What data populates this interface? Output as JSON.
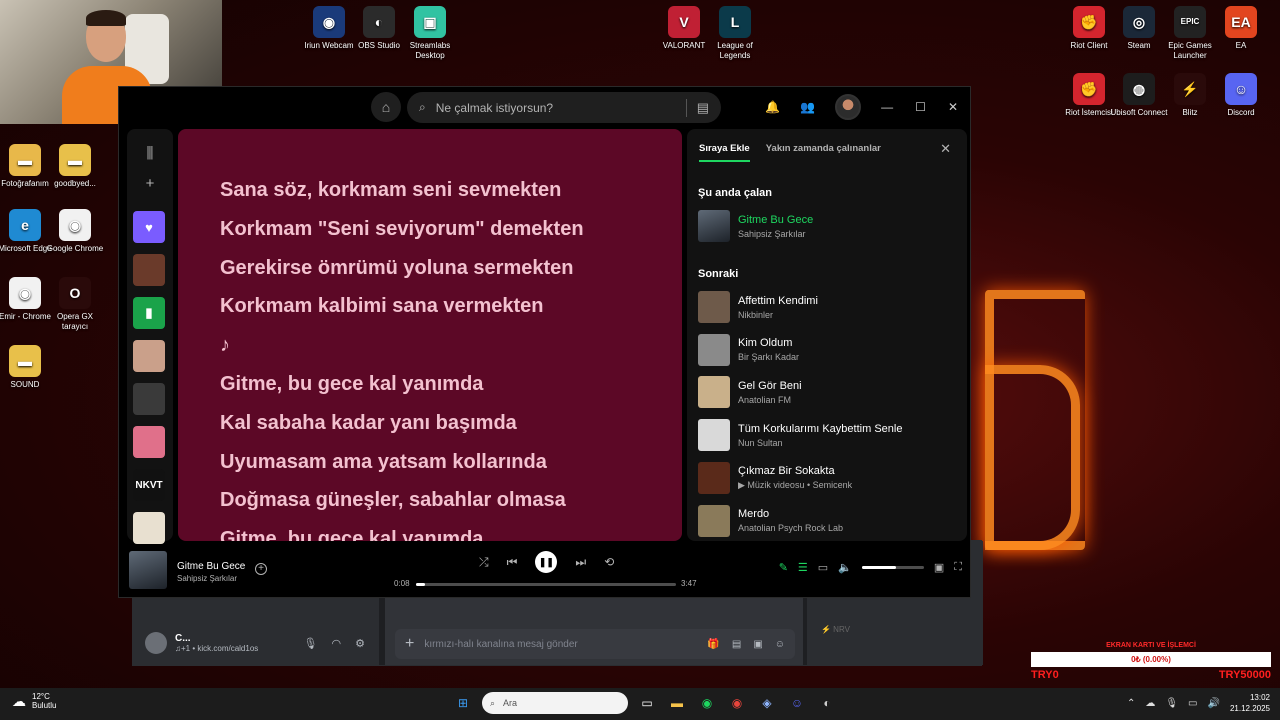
{
  "desktop_icons": [
    {
      "label": "Iriun Webcam",
      "color": "#1a3a7a",
      "glyph": "◉"
    },
    {
      "label": "OBS Studio",
      "color": "#2b2b2b",
      "glyph": "◐"
    },
    {
      "label": "Streamlabs Desktop",
      "color": "#31c3a2",
      "glyph": "▣"
    },
    {
      "label": "VALORANT",
      "color": "#c02034",
      "glyph": "V"
    },
    {
      "label": "League of Legends",
      "color": "#0b3a4a",
      "glyph": "L"
    },
    {
      "label": "Riot Client",
      "color": "#d4252e",
      "glyph": "✊"
    },
    {
      "label": "Steam",
      "color": "#1b2838",
      "glyph": "◎"
    },
    {
      "label": "Epic Games Launcher",
      "color": "#222222",
      "glyph": "EPIC"
    },
    {
      "label": "EA",
      "color": "#e2451f",
      "glyph": "EA"
    },
    {
      "label": "Riot İstemcisi",
      "color": "#d4252e",
      "glyph": "✊"
    },
    {
      "label": "Ubisoft Connect",
      "color": "#1d1d1d",
      "glyph": "◍"
    },
    {
      "label": "Blitz",
      "color": "#2a0a0a",
      "glyph": "⚡"
    },
    {
      "label": "Discord",
      "color": "#5865f2",
      "glyph": "☺"
    },
    {
      "label": "Fotoğrafanım",
      "color": "#e8b84a",
      "glyph": "▬"
    },
    {
      "label": "goodbyed...",
      "color": "#e8c04a",
      "glyph": "▬"
    },
    {
      "label": "Microsoft Edge",
      "color": "#1f8ad2",
      "glyph": "e"
    },
    {
      "label": "Google Chrome",
      "color": "#f1f1f1",
      "glyph": "◉"
    },
    {
      "label": "Emir - Chrome",
      "color": "#f1f1f1",
      "glyph": "◉"
    },
    {
      "label": "Opera GX tarayıcı",
      "color": "#2a0a0a",
      "glyph": "O"
    },
    {
      "label": "SOUND",
      "color": "#e8c04a",
      "glyph": "▬"
    }
  ],
  "spotify": {
    "search_placeholder": "Ne çalmak istiyorsun?",
    "lyrics": [
      "Sana söz, korkmam seni sevmekten",
      "Korkmam \"Seni seviyorum\" demekten",
      "Gerekirse ömrümü yoluna sermekten",
      "Korkmam kalbimi sana vermekten",
      "♪",
      "Gitme, bu gece kal yanımda",
      "Kal sabaha kadar yanı başımda",
      "Uyumasam ama yatsam kollarında",
      "Doğmasa güneşler, sabahlar olmasa",
      "Gitme, bu gece kal yanımda"
    ],
    "queue": {
      "tab_active": "Sıraya Ekle",
      "tab_recent": "Yakın zamanda çalınanlar",
      "now_playing_heading": "Şu anda çalan",
      "next_heading": "Sonraki",
      "now_playing": {
        "title": "Gitme Bu Gece",
        "artist": "Sahipsiz Şarkılar"
      },
      "next": [
        {
          "title": "Affettim Kendimi",
          "artist": "Nikbinler",
          "color": "#6e5a4a"
        },
        {
          "title": "Kim Oldum",
          "artist": "Bir Şarkı Kadar",
          "color": "#8a8a8a"
        },
        {
          "title": "Gel Gör Beni",
          "artist": "Anatolian FM",
          "color": "#c9b08a"
        },
        {
          "title": "Tüm Korkularımı Kaybettim Senle",
          "artist": "Nun Sultan",
          "color": "#d9d9d9"
        },
        {
          "title": "Çıkmaz Bir Sokakta",
          "artist": "▶ Müzik videosu • Semicenk",
          "color": "#5a2a1a"
        },
        {
          "title": "Merdo",
          "artist": "Anatolian Psych Rock Lab",
          "color": "#8a7a5a"
        }
      ]
    },
    "player": {
      "title": "Gitme Bu Gece",
      "artist": "Sahipsiz Şarkılar",
      "elapsed": "0:08",
      "duration": "3:47",
      "progress": 0.035,
      "volume": 0.55
    },
    "library_tiles": [
      {
        "color": "#7a5cff",
        "glyph": "♥"
      },
      {
        "color": "#6a3a2a",
        "glyph": ""
      },
      {
        "color": "#1aa34a",
        "glyph": "▮"
      },
      {
        "color": "#caa08a",
        "glyph": ""
      },
      {
        "color": "#3a3a3a",
        "glyph": ""
      },
      {
        "color": "#e0708a",
        "glyph": ""
      },
      {
        "color": "#111111",
        "glyph": "NKVT"
      },
      {
        "color": "#e8e0d0",
        "glyph": ""
      }
    ]
  },
  "discord": {
    "user_name": "C...",
    "user_status": "♫+1 • kick.com/cald1os",
    "message_placeholder": "kırmızı-halı kanalına mesaj gönder",
    "member_tag": "⚡ NRV"
  },
  "overlay": {
    "title": "EKRAN KARTI VE İŞLEMCİ",
    "progress_text": "0₺ (0.00%)",
    "min": "TRY0",
    "max": "TRY50000"
  },
  "taskbar": {
    "temperature": "12°C",
    "weather": "Bulutlu",
    "search": "Ara",
    "time": "13:02",
    "date": "21.12.2025"
  }
}
